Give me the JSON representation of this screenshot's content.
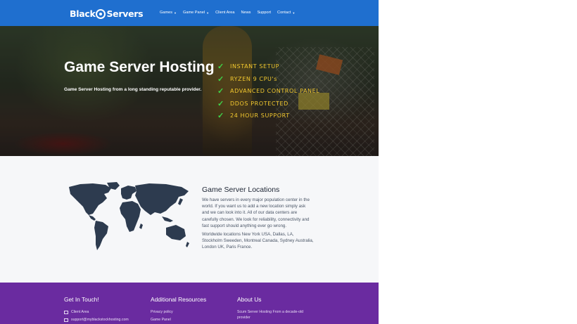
{
  "header": {
    "logo_left": "Black",
    "logo_right": "Servers",
    "nav": [
      {
        "label": "Games",
        "has_dropdown": true
      },
      {
        "label": "Game Panel",
        "has_dropdown": true
      },
      {
        "label": "Client Area",
        "has_dropdown": false
      },
      {
        "label": "News",
        "has_dropdown": false
      },
      {
        "label": "Support",
        "has_dropdown": false
      },
      {
        "label": "Contact",
        "has_dropdown": true
      }
    ]
  },
  "hero": {
    "title": "Game Server Hosting",
    "subtitle": "Game Server Hosting from a long standing reputable provider.",
    "features": [
      "INSTANT SETUP",
      "RYZEN 9 CPU's",
      "ADVANCED CONTROL PANEL",
      "DDOS PROTECTED",
      "24 HOUR SUPPORT"
    ]
  },
  "locations": {
    "title": "Game Server Locations",
    "body": "We have servers in every major population center in the world. If you want us to add a new location simply ask and we can look into it. All of our data centers are carefully chosen.  We look for reliability, connectivity and fast support should anything ever go wrong.",
    "body2": "Worldwide locations New York USA, Dallas, LA, Stockholm Sweeden, Montreal Canada,  Sydney Australia, London UK, Paris France."
  },
  "footer": {
    "col1": {
      "heading": "Get In Touch!",
      "items": [
        "Client Area",
        "support@myblackstockhosting.com"
      ]
    },
    "col2": {
      "heading": "Additional Resources",
      "items": [
        "Privacy policy",
        "Game Panel"
      ]
    },
    "col3": {
      "heading": "About Us",
      "text": "Scum Server Hosting From a decade-old provider"
    }
  },
  "colors": {
    "header_bg": "#1f6fcf",
    "footer_bg": "#6a2ba0",
    "feature_text": "#f2c82f",
    "check": "#3fd44a",
    "map": "#2d3b4f"
  }
}
